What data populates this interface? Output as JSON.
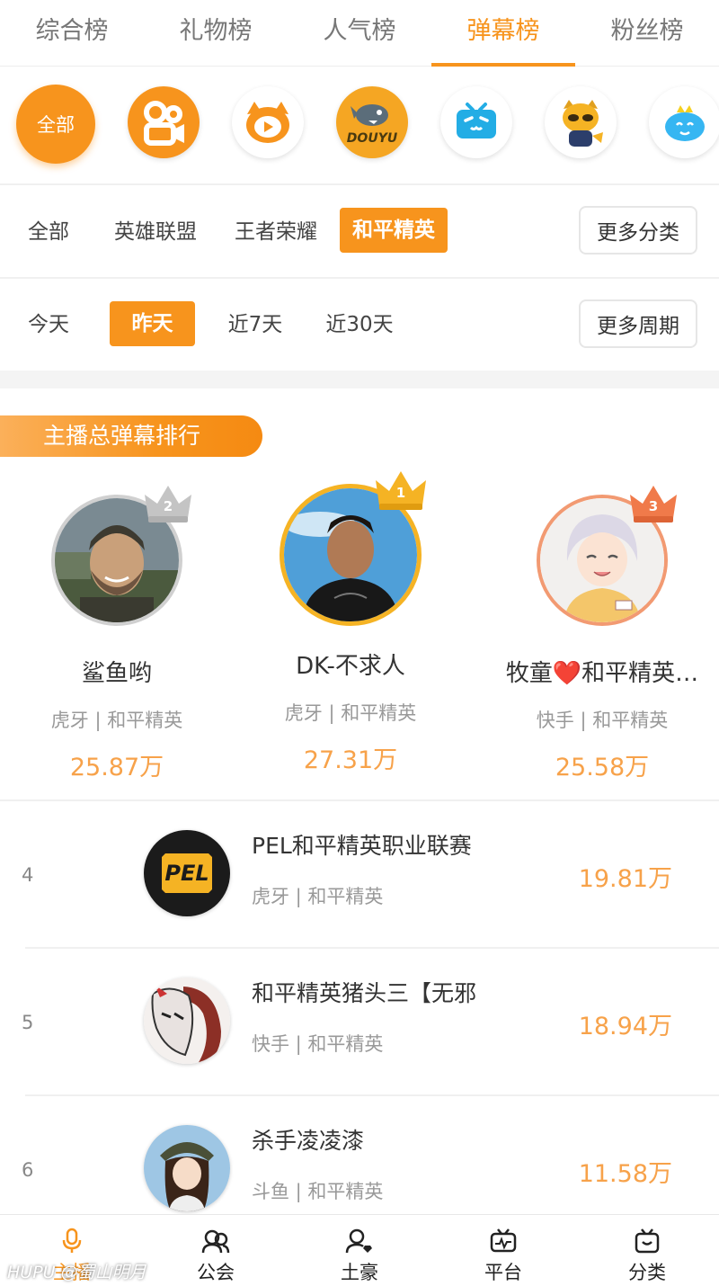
{
  "top_tabs": [
    "综合榜",
    "礼物榜",
    "人气榜",
    "弹幕榜",
    "粉丝榜"
  ],
  "platforms": {
    "all_label": "全部",
    "items": [
      {
        "icon": "kuaishou-logo",
        "color": "#f7941d"
      },
      {
        "icon": "huya-logo",
        "color": "#f7941d"
      },
      {
        "icon": "douyu-logo",
        "color": "#f5a623",
        "text": "DOUYU"
      },
      {
        "icon": "bilibili-logo",
        "color": "#23ade5"
      },
      {
        "icon": "yy-logo",
        "color": "#f5b324"
      },
      {
        "icon": "cloud-logo",
        "color": "#36b6f2"
      }
    ]
  },
  "games": {
    "items": [
      "全部",
      "英雄联盟",
      "王者荣耀",
      "和平精英"
    ],
    "active": "和平精英",
    "more": "更多分类"
  },
  "periods": {
    "items": [
      "今天",
      "昨天",
      "近7天",
      "近30天"
    ],
    "active": "昨天",
    "more": "更多周期"
  },
  "section_title": "主播总弹幕排行",
  "podium": [
    {
      "rank": "2",
      "name": "鲨鱼哟",
      "sub": "虎牙 | 和平精英",
      "score": "25.87万",
      "crown_color": "#c4c4c4"
    },
    {
      "rank": "1",
      "name": "DK-不求人",
      "sub": "虎牙 | 和平精英",
      "score": "27.31万",
      "crown_color": "#f5b324"
    },
    {
      "rank": "3",
      "name": "牧童❤️和平精英…",
      "sub": "快手 | 和平精英",
      "score": "25.58万",
      "crown_color": "#f07a4a"
    }
  ],
  "list": [
    {
      "rank": "4",
      "name": "PEL和平精英职业联赛",
      "sub": "虎牙 | 和平精英",
      "score": "19.81万"
    },
    {
      "rank": "5",
      "name": "和平精英猪头三【无邪",
      "sub": "快手 | 和平精英",
      "score": "18.94万"
    },
    {
      "rank": "6",
      "name": "杀手凌凌漆",
      "sub": "斗鱼 | 和平精英",
      "score": "11.58万"
    }
  ],
  "bottom_nav": [
    {
      "label": "主播",
      "icon": "mic-icon"
    },
    {
      "label": "公会",
      "icon": "guild-icon"
    },
    {
      "label": "土豪",
      "icon": "rich-user-icon"
    },
    {
      "label": "平台",
      "icon": "platform-icon"
    },
    {
      "label": "分类",
      "icon": "category-icon"
    }
  ],
  "accent_color": "#f7941d",
  "watermark": "HUPU @蜀山明月"
}
